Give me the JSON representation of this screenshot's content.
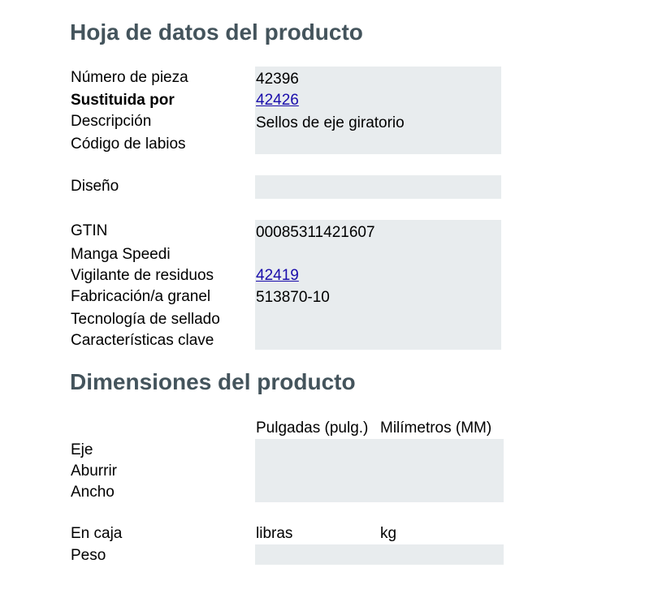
{
  "datasheet": {
    "title": "Hoja de datos del producto",
    "part_number_label": "Número de pieza",
    "part_number_value": "42396",
    "replaced_by_label": "Sustituida por",
    "replaced_by_value": "42426",
    "description_label": "Descripción",
    "description_value": "Sellos de eje giratorio",
    "lip_code_label": "Código de labios",
    "design_label": "Diseño",
    "gtin_label": "GTIN",
    "gtin_value": "00085311421607",
    "speedi_sleeve_label": "Manga Speedi",
    "waste_guard_label": "Vigilante de residuos",
    "waste_guard_value": "42419",
    "bulk_label": "Fabricación/a granel",
    "bulk_value": "513870-10",
    "seal_tech_label": "Tecnología de sellado",
    "key_features_label": "Características clave"
  },
  "dimensions": {
    "title": "Dimensiones del producto",
    "inches_header": "Pulgadas (pulg.)",
    "mm_header": "Milímetros (MM)",
    "shaft_label": "Eje",
    "bore_label": "Aburrir",
    "width_label": "Ancho",
    "boxed_label": "En caja",
    "lbs_header": "libras",
    "kg_header": "kg",
    "weight_label": "Peso"
  }
}
